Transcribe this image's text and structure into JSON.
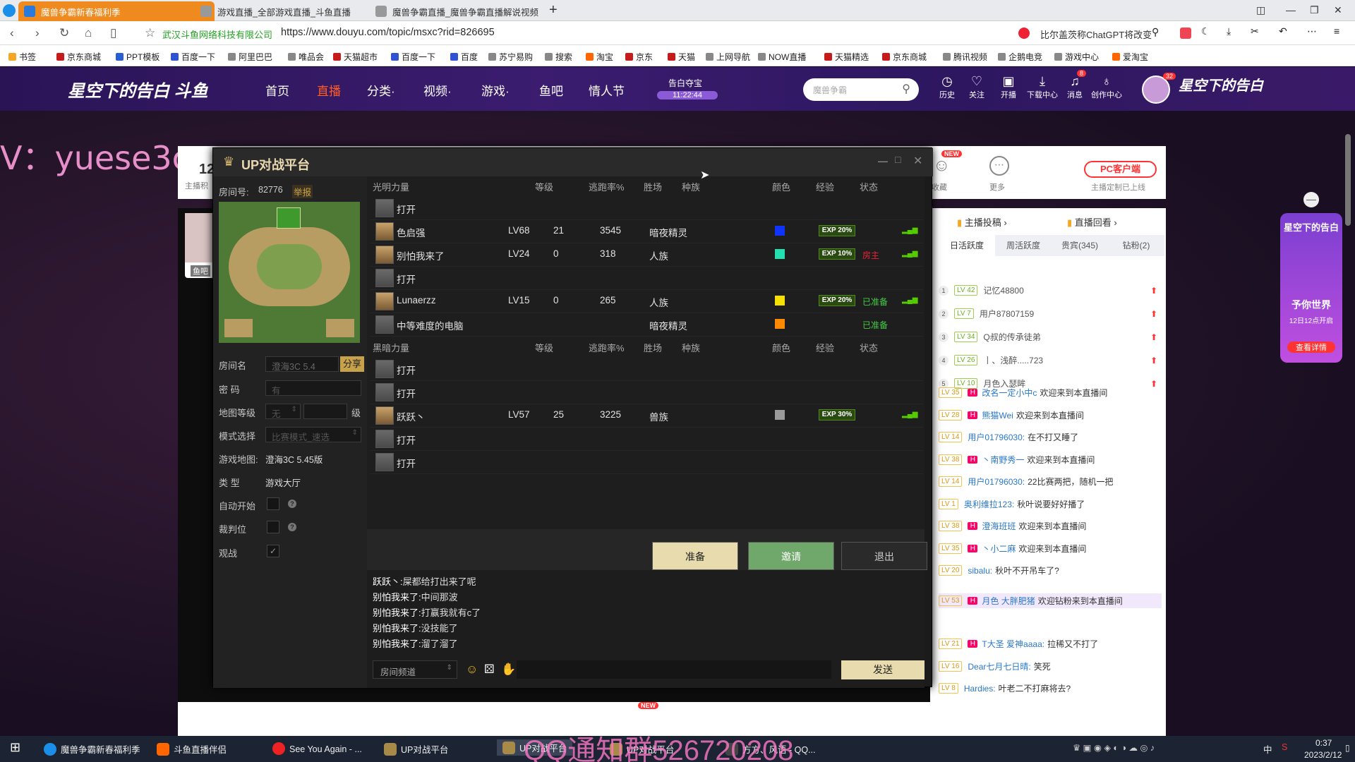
{
  "browser": {
    "tabs": [
      {
        "title": "魔兽争霸新春福利季"
      },
      {
        "title": "游戏直播_全部游戏直播_斗鱼直播"
      },
      {
        "title": "魔兽争霸直播_魔兽争霸直播解说视频"
      }
    ],
    "new_tab": "+",
    "site_label": "武汉斗鱼网络科技有限公司",
    "url": "https://www.douyu.com/topic/msxc?rid=826695",
    "search_text": "比尔盖茨称ChatGPT将改变"
  },
  "bookmarks": [
    "书签",
    "京东商城",
    "PPT模板",
    "百度一下",
    "阿里巴巴",
    "唯品会",
    "天猫超市",
    "百度一下",
    "百度",
    "苏宁易购",
    "搜索",
    "淘宝",
    "京东",
    "天猫",
    "上网导航",
    "NOW直播",
    "天猫精选",
    "京东商城",
    "腾讯视频",
    "企鹅电竞",
    "游戏中心",
    "爱淘宝"
  ],
  "site": {
    "logo_text": "星空下的告白 斗鱼",
    "nav": [
      "首页",
      "直播",
      "分类·",
      "视频·",
      "游戏·",
      "鱼吧",
      "情人节"
    ],
    "countdown_label": "告白夺宝",
    "countdown_time": "11:22:44",
    "search_placeholder": "魔兽争霸",
    "tools": [
      "历史",
      "关注",
      "开播",
      "下载中心",
      "消息",
      "创作中心"
    ],
    "notif_count": "8",
    "avatar_badge": "32",
    "watermark": "V：yuese3c",
    "pc_client": "PC客户端",
    "anchor_note": "主播定制已上线",
    "more": "更多",
    "partial_left": "12",
    "partial_left2": "主播积",
    "yuba": "鱼吧",
    "anchor_vote": "主播投稿",
    "replay": "直播回看",
    "new_badge": "NEW",
    "collect_text": "收藏",
    "promo_top": "星空下的告白",
    "promo_mid": "予你世界",
    "promo_date": "12日12点开启",
    "promo_btn": "查看详情"
  },
  "ranking": {
    "tabs": [
      "日活跃度",
      "周活跃度",
      "贵宾(345)",
      "钻粉(2)"
    ],
    "rows": [
      {
        "rank": "1",
        "lv": "LV 42",
        "name": "记忆48800"
      },
      {
        "rank": "2",
        "lv": "LV 7",
        "name": "用户87807159"
      },
      {
        "rank": "3",
        "lv": "LV 34",
        "name": "Q叔的传承徒弟"
      },
      {
        "rank": "4",
        "lv": "LV 26",
        "name": "丨、浅醉.....723"
      },
      {
        "rank": "5",
        "lv": "LV 10",
        "name": "月色入瑟眸"
      }
    ]
  },
  "danmu": [
    {
      "lv": "LV 35",
      "user": "改名一定小中c",
      "text": "欢迎来到本直播间"
    },
    {
      "lv": "LV 28",
      "user": "熊猫Wei",
      "text": "欢迎来到本直播间"
    },
    {
      "lv": "LV 14",
      "user": "用户01796030:",
      "text": "在不打又睡了"
    },
    {
      "lv": "LV 38",
      "user": "丶南野秀一",
      "text": "欢迎来到本直播间"
    },
    {
      "lv": "LV 14",
      "user": "用户01796030:",
      "text": "22比赛两把，随机一把"
    },
    {
      "lv": "LV 1",
      "user": "奥利维拉123:",
      "text": "秋叶说要好好播了"
    },
    {
      "lv": "LV 38",
      "user": "澄海班班",
      "text": "欢迎来到本直播间"
    },
    {
      "lv": "LV 35",
      "user": "丶小二麻",
      "text": "欢迎来到本直播间"
    },
    {
      "lv": "LV 20",
      "user": "sibalu:",
      "text": "秋叶不开吊车了?"
    },
    {
      "lv": "LV 53",
      "user": "月色 大胖肥猪",
      "text": "欢迎钻粉来到本直播间"
    },
    {
      "lv": "LV 21",
      "user": "T大圣 爱神aaaa:",
      "text": "拉稀又不打了"
    },
    {
      "lv": "LV 16",
      "user": "Dear七月七日晴:",
      "text": "笑死"
    },
    {
      "lv": "LV 8",
      "user": "Hardies:",
      "text": "叶老二不打麻将去?"
    }
  ],
  "game": {
    "title": "UP对战平台",
    "room_no_label": "房间号:",
    "room_no": "82776",
    "report": "举报",
    "room_name_label": "房间名",
    "room_name": "澄海3C 5.4",
    "share": "分享",
    "password_label": "密  码",
    "password_ph": "有",
    "map_level_label": "地图等级",
    "map_level": "无",
    "level_unit": "级",
    "mode_label": "模式选择",
    "mode": "比赛模式_速选",
    "game_map_label": "游戏地图:",
    "game_map": "澄海3C 5.45版",
    "type_label": "类  型",
    "type": "游戏大厅",
    "auto_start": "自动开始",
    "referee": "裁判位",
    "observe": "观战",
    "headers": [
      "光明力量",
      "等级",
      "逃跑率%",
      "胜场",
      "种族",
      "颜色",
      "经验",
      "状态"
    ],
    "headers_dark": [
      "黑暗力量",
      "等级",
      "逃跑率%",
      "胜场",
      "种族",
      "颜色",
      "经验",
      "状态"
    ],
    "light": [
      {
        "name": "打开",
        "lv": "",
        "flee": "",
        "win": "",
        "race": "",
        "color": "",
        "exp": "",
        "status": ""
      },
      {
        "name": "色启强",
        "lv": "LV68",
        "flee": "21",
        "win": "3545",
        "race": "暗夜精灵",
        "color": "#1034ff",
        "exp": "EXP 20%",
        "status": ""
      },
      {
        "name": "别怕我来了",
        "lv": "LV24",
        "flee": "0",
        "win": "318",
        "race": "人族",
        "color": "#22e0b0",
        "exp": "EXP 10%",
        "status": "房主"
      },
      {
        "name": "打开",
        "lv": "",
        "flee": "",
        "win": "",
        "race": "",
        "color": "",
        "exp": "",
        "status": ""
      },
      {
        "name": "Lunaerzz",
        "lv": "LV15",
        "flee": "0",
        "win": "265",
        "race": "人族",
        "color": "#f6e000",
        "exp": "EXP 20%",
        "status": "已准备"
      },
      {
        "name": "中等难度的电脑",
        "lv": "",
        "flee": "",
        "win": "",
        "race": "暗夜精灵",
        "color": "#ff8a00",
        "exp": "",
        "status": "已准备"
      }
    ],
    "dark": [
      {
        "name": "打开",
        "lv": "",
        "flee": "",
        "win": "",
        "race": "",
        "color": "",
        "exp": "",
        "status": ""
      },
      {
        "name": "打开",
        "lv": "",
        "flee": "",
        "win": "",
        "race": "",
        "color": "",
        "exp": "",
        "status": ""
      },
      {
        "name": "跃跃丶",
        "lv": "LV57",
        "flee": "25",
        "win": "3225",
        "race": "兽族",
        "color": "#9a9a9a",
        "exp": "EXP 30%",
        "status": ""
      },
      {
        "name": "打开",
        "lv": "",
        "flee": "",
        "win": "",
        "race": "",
        "color": "",
        "exp": "",
        "status": ""
      },
      {
        "name": "打开",
        "lv": "",
        "flee": "",
        "win": "",
        "race": "",
        "color": "",
        "exp": "",
        "status": ""
      }
    ],
    "btn_ready": "准备",
    "btn_invite": "邀请",
    "btn_exit": "退出",
    "chat": [
      {
        "who": "跃跃丶:",
        "msg": "屎都给打出来了呢"
      },
      {
        "who": "别怕我来了:",
        "msg": "中间那波"
      },
      {
        "who": "别怕我来了:",
        "msg": "打赢我就有c了"
      },
      {
        "who": "别怕我来了:",
        "msg": "没技能了"
      },
      {
        "who": "别怕我来了:",
        "msg": "溜了溜了"
      }
    ],
    "channel": "房间频道",
    "send": "发送"
  },
  "taskbar": {
    "items": [
      "魔兽争霸新春福利季",
      "斗鱼直播伴侣",
      "See You Again - ...",
      "UP对战平台",
      "UP对战平台",
      "UP对战平台",
      "方方、风语 - QQ..."
    ],
    "time": "0:37",
    "date": "2023/2/12",
    "ime": "中",
    "overlay": "QQ通知群526720208"
  }
}
